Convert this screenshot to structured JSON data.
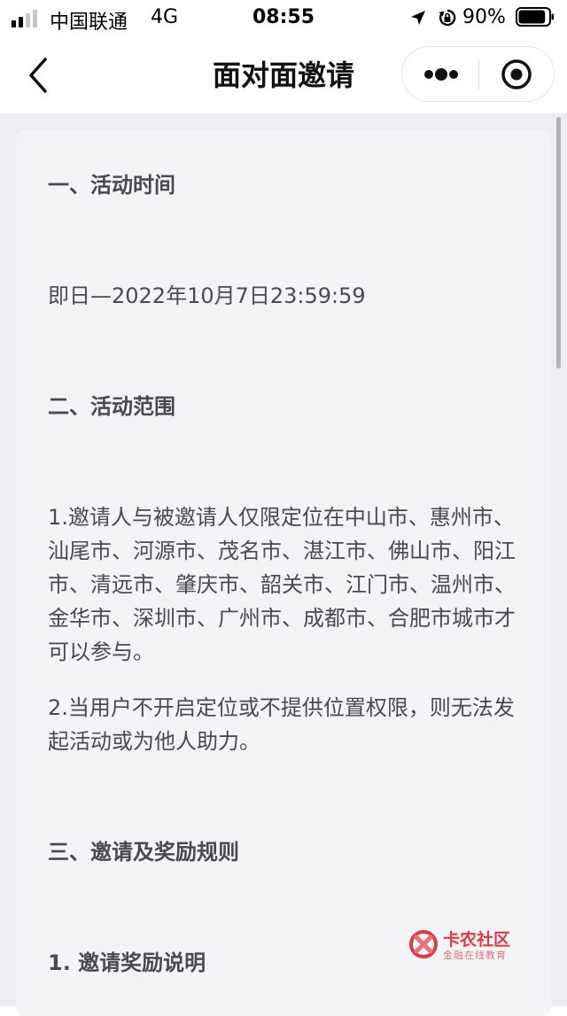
{
  "status_bar": {
    "carrier": "中国联通",
    "network": "4G",
    "time": "08:55",
    "battery_percent": "90%",
    "battery_level": 0.9,
    "signal_bars": 2
  },
  "nav": {
    "title": "面对面邀请"
  },
  "content": {
    "section1_title": "一、活动时间",
    "section1_body": "即日—2022年10月7日23:59:59",
    "section2_title": "二、活动范围",
    "section2_p1": "1.邀请人与被邀请人仅限定位在中山市、惠州市、汕尾市、河源市、茂名市、湛江市、佛山市、阳江市、清远市、肇庆市、韶关市、江门市、温州市、金华市、深圳市、广州市、成都市、合肥市城市才可以参与。",
    "section2_p2": "2.当用户不开启定位或不提供位置权限，则无法发起活动或为他人助力。",
    "section3_title": "三、邀请及奖励规则",
    "section3_sub1": "1. 邀请奖励说明"
  },
  "watermark": {
    "title": "卡农社区",
    "subtitle": "金融在线教育"
  },
  "colors": {
    "page_bg": "#eeeef2",
    "card_bg": "#f4f4f7",
    "text": "#4a4a4e",
    "watermark": "#d63d48"
  }
}
